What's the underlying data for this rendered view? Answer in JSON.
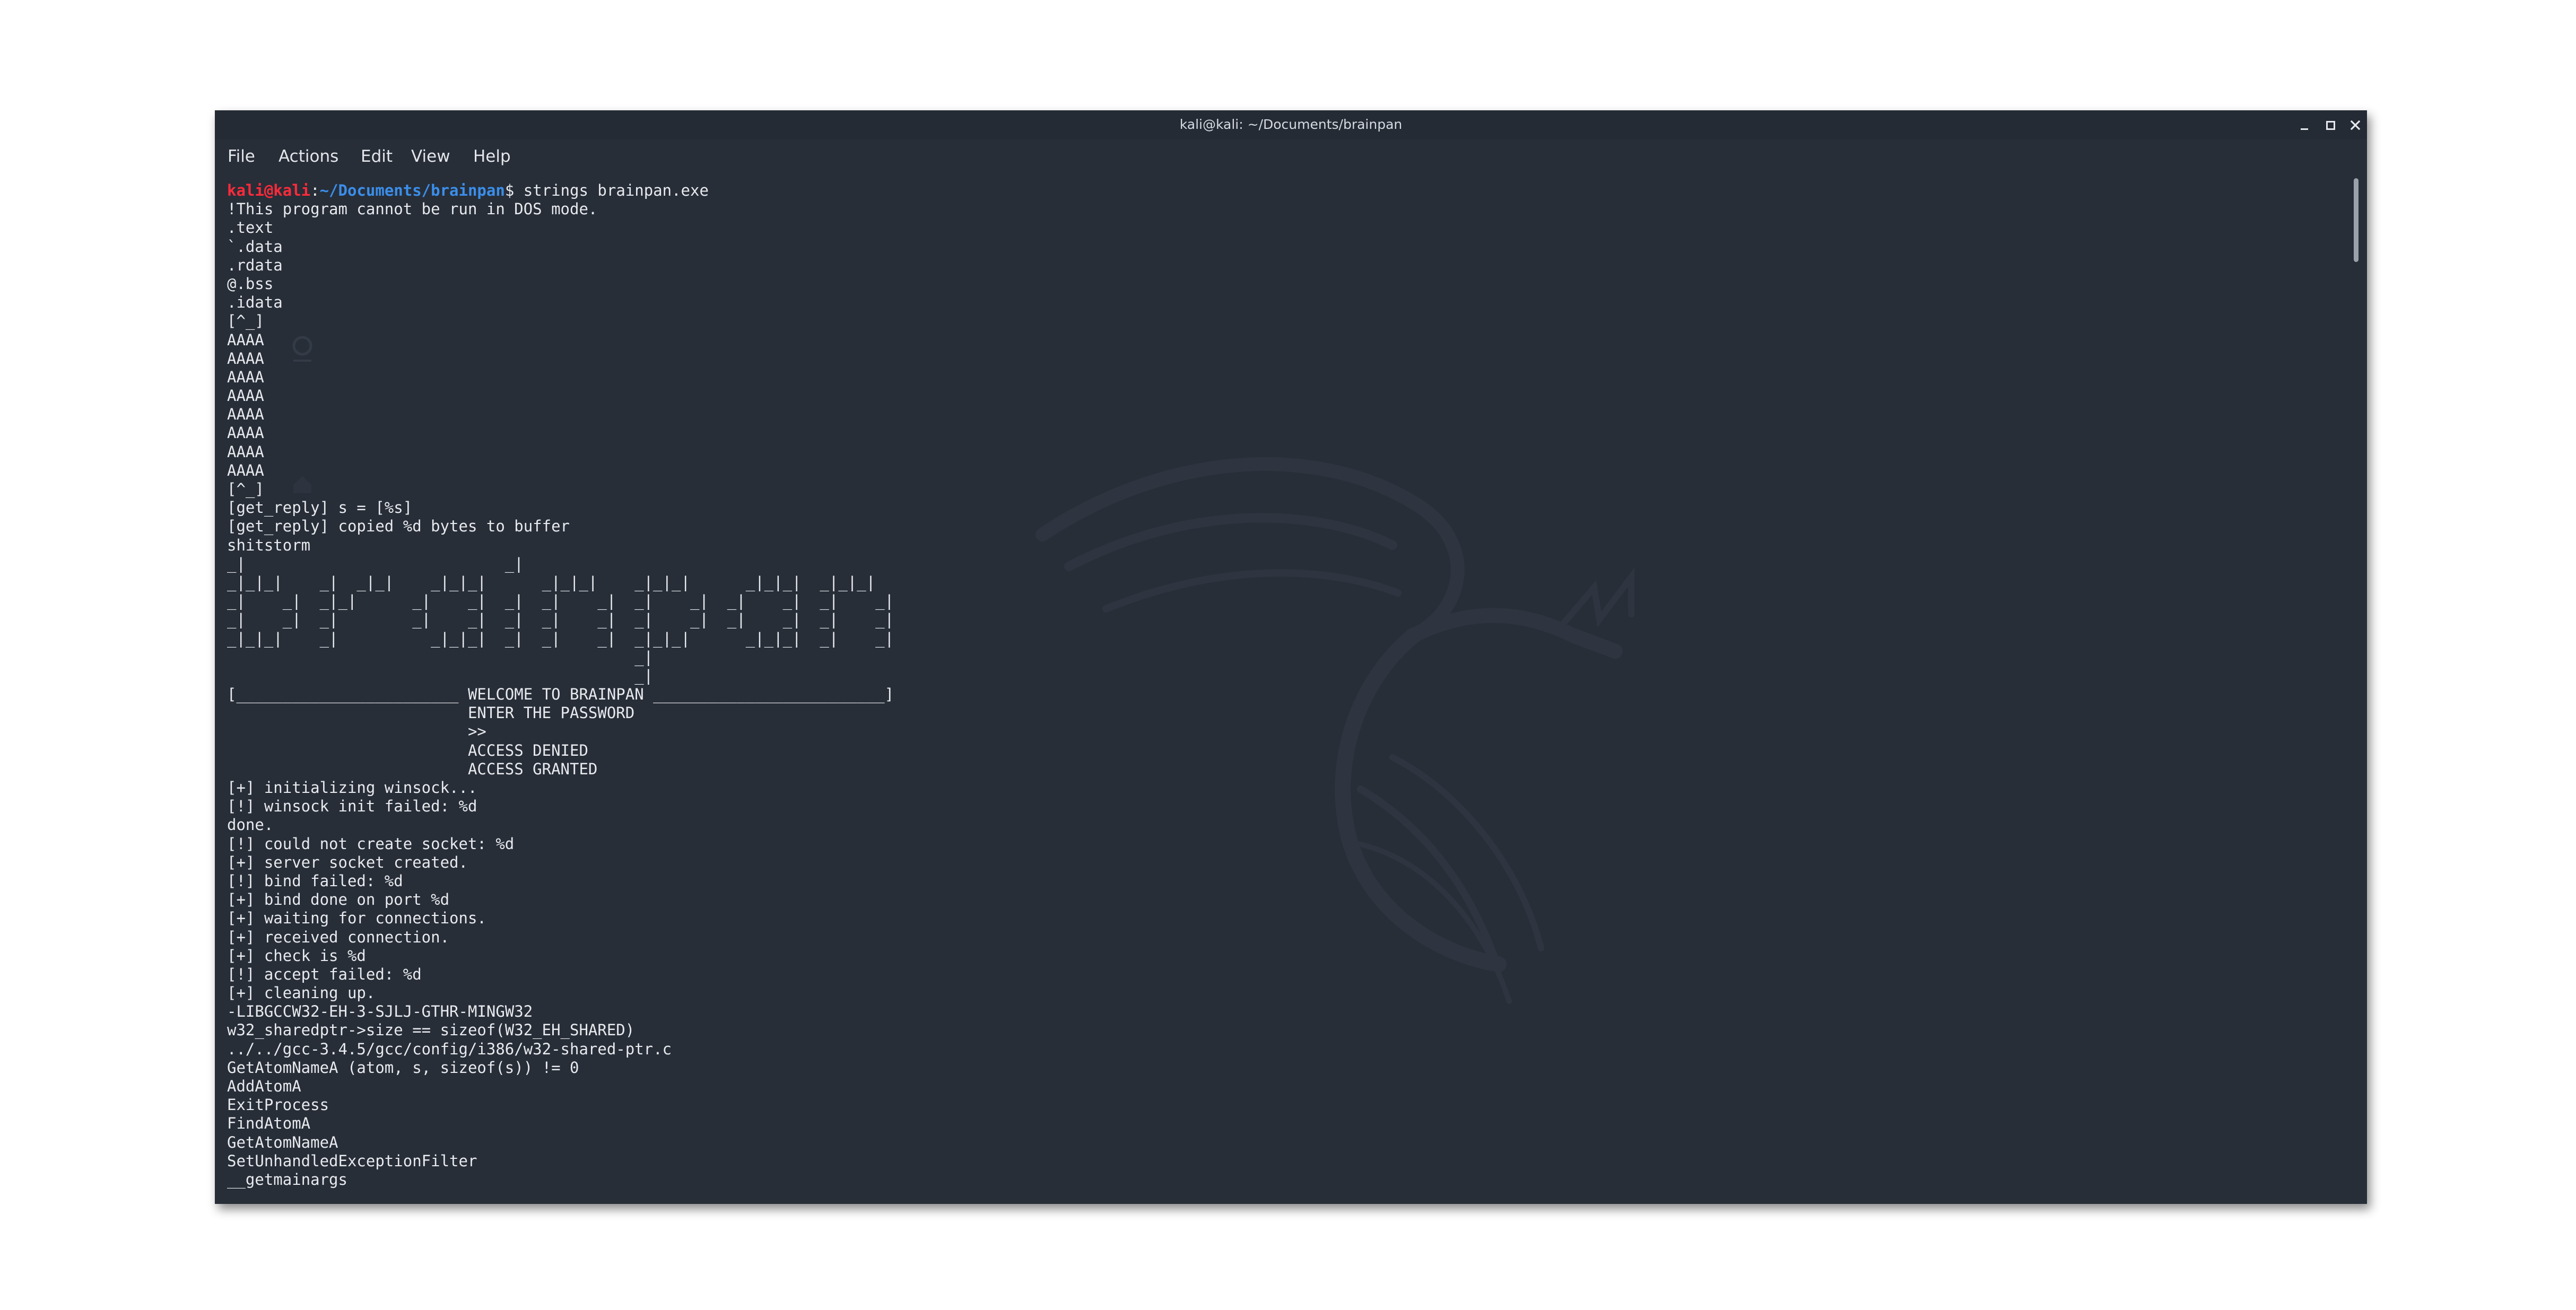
{
  "window": {
    "title": "kali@kali: ~/Documents/brainpan",
    "controls": {
      "minimize": "minimize-icon",
      "maximize": "maximize-icon",
      "close": "close-icon"
    }
  },
  "menu": {
    "file": "File",
    "actions": "Actions",
    "edit": "Edit",
    "view": "View",
    "help": "Help"
  },
  "colors": {
    "terminal_bg": "#272e38",
    "prompt_user": "#ff2a3a",
    "prompt_path": "#3b8eea",
    "text": "#e8eaee"
  },
  "terminal": {
    "prompt": {
      "user": "kali@kali",
      "sep": ":",
      "path": "~/Documents/brainpan",
      "symbol": "$",
      "command": " strings brainpan.exe"
    },
    "lines": [
      "!This program cannot be run in DOS mode.",
      ".text",
      "`.data",
      ".rdata",
      "@.bss",
      ".idata",
      "[^_]",
      "AAAA",
      "AAAA",
      "AAAA",
      "AAAA",
      "AAAA",
      "AAAA",
      "AAAA",
      "AAAA",
      "[^_]",
      "[get_reply] s = [%s]",
      "[get_reply] copied %d bytes to buffer",
      "shitstorm",
      "_|                            _|",
      "_|_|_|    _|  _|_|    _|_|_|      _|_|_|    _|_|_|      _|_|_|  _|_|_|",
      "_|    _|  _|_|      _|    _|  _|  _|    _|  _|    _|  _|    _|  _|    _|",
      "_|    _|  _|        _|    _|  _|  _|    _|  _|    _|  _|    _|  _|    _|",
      "_|_|_|    _|          _|_|_|  _|  _|    _|  _|_|_|      _|_|_|  _|    _|",
      "                                            _|",
      "                                            _|",
      "[________________________ WELCOME TO BRAINPAN _________________________]",
      "                          ENTER THE PASSWORD",
      "                          >>",
      "                          ACCESS DENIED",
      "                          ACCESS GRANTED",
      "[+] initializing winsock...",
      "[!] winsock init failed: %d",
      "done.",
      "[!] could not create socket: %d",
      "[+] server socket created.",
      "[!] bind failed: %d",
      "[+] bind done on port %d",
      "[+] waiting for connections.",
      "[+] received connection.",
      "[+] check is %d",
      "[!] accept failed: %d",
      "[+] cleaning up.",
      "-LIBGCCW32-EH-3-SJLJ-GTHR-MINGW32",
      "w32_sharedptr->size == sizeof(W32_EH_SHARED)",
      "../../gcc-3.4.5/gcc/config/i386/w32-shared-ptr.c",
      "GetAtomNameA (atom, s, sizeof(s)) != 0",
      "AddAtomA",
      "ExitProcess",
      "FindAtomA",
      "GetAtomNameA",
      "SetUnhandledExceptionFilter",
      "__getmainargs"
    ]
  }
}
